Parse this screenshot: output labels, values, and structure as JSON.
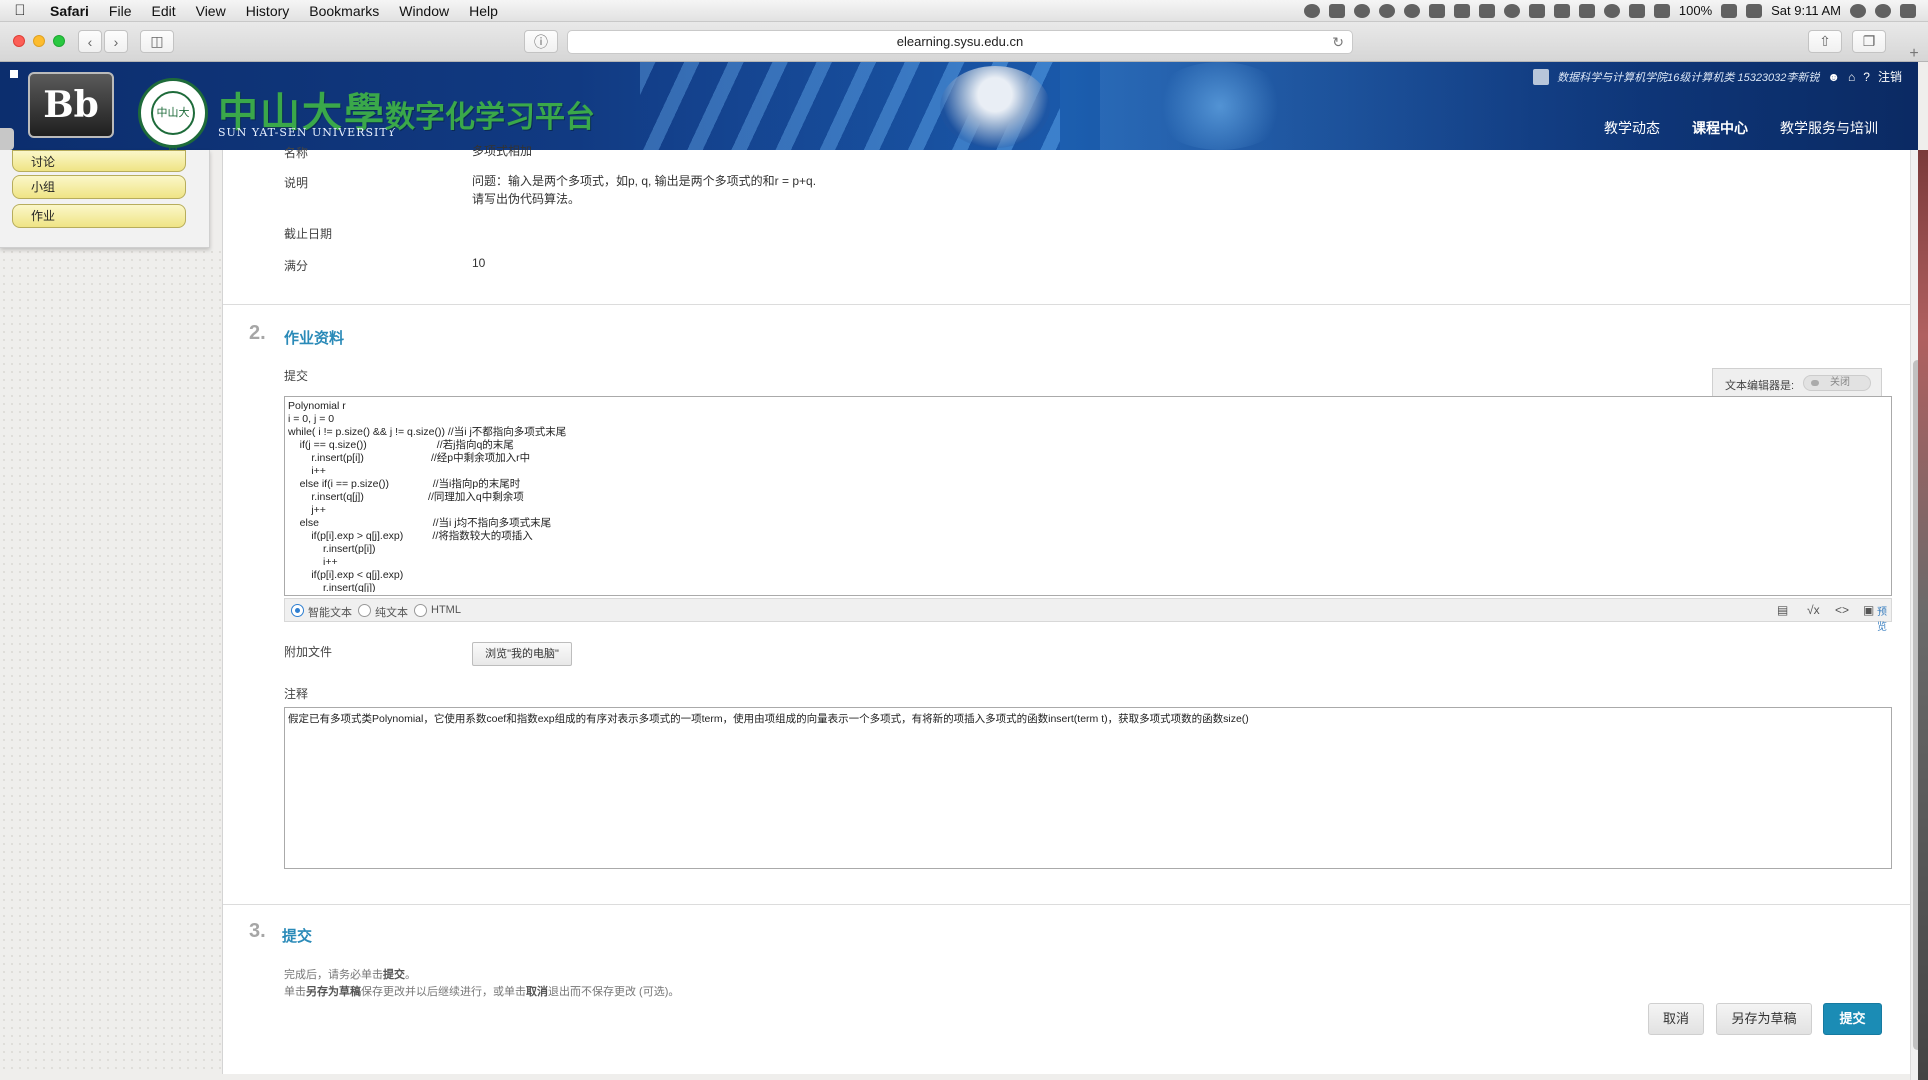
{
  "menubar": {
    "app": "Safari",
    "items": [
      "File",
      "Edit",
      "View",
      "History",
      "Bookmarks",
      "Window",
      "Help"
    ],
    "battery": "100%",
    "clock": "Sat 9:11 AM"
  },
  "browser": {
    "url": "elearning.sysu.edu.cn"
  },
  "header": {
    "bb_logo": "Bb",
    "seal_text": "中山大學",
    "uni_name": "中山大學",
    "uni_name_en": "SUN YAT-SEN UNIVERSITY",
    "platform": "数字化学习平台",
    "user": "数据科学与计算机学院16级计算机类 15323032李新锐",
    "logout": "注销",
    "tabs": [
      "教学动态",
      "课程中心",
      "教学服务与培训"
    ],
    "active_tab": "课程中心"
  },
  "leftnav": {
    "items": [
      "讨论",
      "小组",
      "作业"
    ]
  },
  "info": {
    "name_label": "名称",
    "name_value": "多项式相加",
    "desc_label": "说明",
    "desc_line1": "问题：输入是两个多项式，如p, q, 输出是两个多项式的和r = p+q.",
    "desc_line2": "请写出伪代码算法。",
    "due_label": "截止日期",
    "points_label": "满分",
    "points_value": "10"
  },
  "section2": {
    "num": "2.",
    "title": "作业资料",
    "submit_label": "提交",
    "editor_toggle_label": "文本编辑器是:",
    "editor_toggle_state": "关闭",
    "code": "Polynomial r\ni = 0, j = 0\nwhile( i != p.size() && j != q.size()) //当i j不都指向多项式末尾\n    if(j == q.size())                        //若j指向q的末尾\n        r.insert(p[i])                       //经p中剩余项加入r中\n        i++\n    else if(i == p.size())               //当i指向p的末尾时\n        r.insert(q[j])                      //同理加入q中剩余项\n        j++\n    else                                       //当i j均不指向多项式末尾\n        if(p[i].exp > q[j].exp)          //将指数较大的项插入\n            r.insert(p[i])\n            i++\n        if(p[i].exp < q[j].exp)\n            r.insert(q[j])",
    "modes": [
      "智能文本",
      "纯文本",
      "HTML"
    ],
    "preview": "预览",
    "attach_label": "附加文件",
    "browse_button": "浏览\"我的电脑\"",
    "notes_label": "注释",
    "notes_text": "假定已有多项式类Polynomial，它使用系数coef和指数exp组成的有序对表示多项式的一项term，使用由项组成的向量表示一个多项式，有将新的项插入多项式的函数insert(term t)，获取多项式项数的函数size()"
  },
  "section3": {
    "num": "3.",
    "title": "提交",
    "line1_pre": "完成后，请务必单击",
    "line1_bold": "提交",
    "line1_post": "。",
    "line2_pre": "单击",
    "line2_bold1": "另存为草稿",
    "line2_mid": "保存更改并以后继续进行，或单击",
    "line2_bold2": "取消",
    "line2_post": "退出而不保存更改 (可选)。",
    "cancel": "取消",
    "save_draft": "另存为草稿",
    "submit": "提交"
  }
}
